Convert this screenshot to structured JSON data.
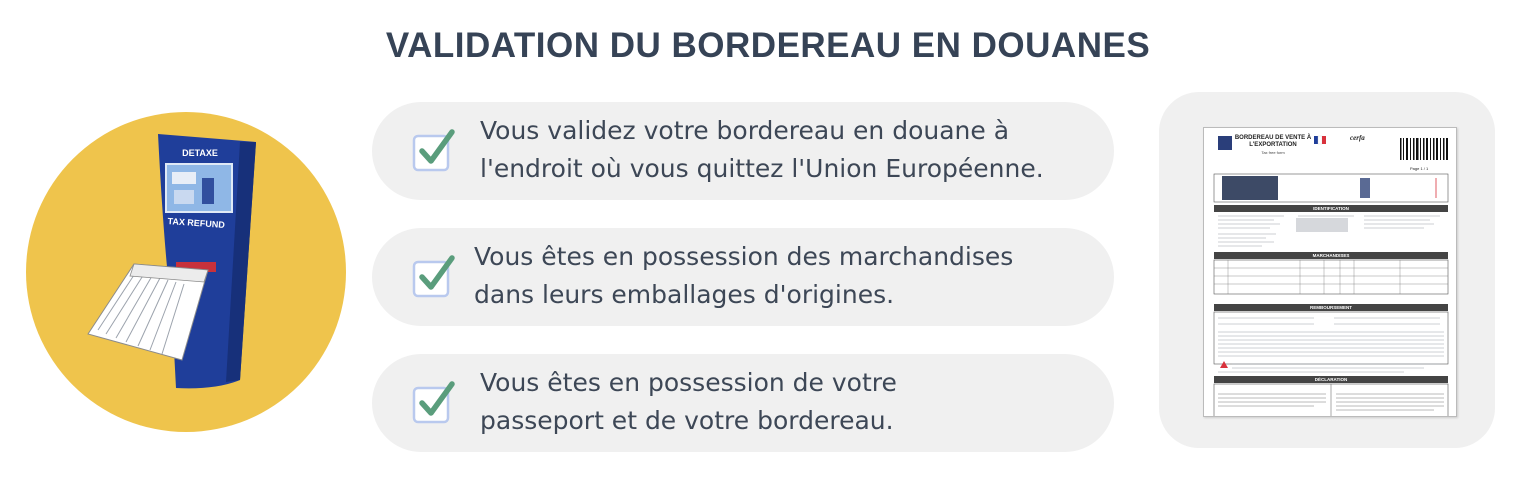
{
  "title": "VALIDATION DU BORDEREAU EN DOUANES",
  "kiosk": {
    "header_label": "DETAXE",
    "footer_label": "TAX REFUND"
  },
  "items": [
    {
      "text_line1": "Vous validez votre bordereau en douane à",
      "text_line2": "l'endroit où vous quittez l'Union Européenne."
    },
    {
      "text_line1": "Vous êtes en possession des marchandises",
      "text_line2": "dans leurs emballages d'origines."
    },
    {
      "text_line1": "Vous êtes en possession de votre",
      "text_line2": "passeport et de votre bordereau."
    }
  ],
  "document": {
    "title": "BORDEREAU DE VENTE À L'EXPORTATION",
    "subtitle": "Tax free form",
    "brand": "cerfa",
    "page": "Page 1 / 1",
    "sections": [
      "IDENTIFICATION",
      "MARCHANDISES",
      "REMBOURSEMENT",
      "DÉCLARATION"
    ]
  },
  "colors": {
    "title": "#364356",
    "circle": "#efc44c",
    "kiosk_blue": "#1f3e9a",
    "check_green": "#5a9d7c",
    "pill_bg": "#f0f0f0"
  }
}
